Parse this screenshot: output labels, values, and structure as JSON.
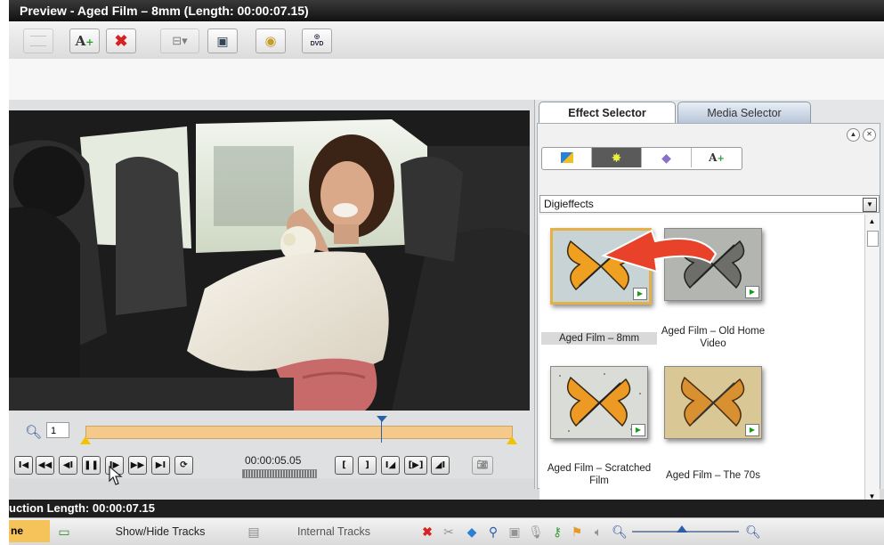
{
  "window": {
    "title": "Preview - Aged Film – 8mm (Length: 00:00:07.15)"
  },
  "toolbar": {
    "buttons": [
      "blank-icon",
      "add-title-icon",
      "delete-icon",
      "align-dropdown-icon",
      "edit-icon",
      "sphere-icon",
      "dvd-icon"
    ],
    "dvd_label": "DVD"
  },
  "preview": {
    "zoom_value": "1",
    "timecode": "00:00:05.05",
    "playhead_fraction": 0.69,
    "progress_fraction": 0.55
  },
  "tabs": {
    "effect_selector": "Effect Selector",
    "media_selector": "Media Selector"
  },
  "effects": {
    "category": "Digieffects",
    "category_tool_text": "A",
    "items": [
      {
        "label": "Aged Film – 8mm",
        "selected": true,
        "style": "color"
      },
      {
        "label": "Aged Film – Old Home Video",
        "selected": false,
        "style": "gray"
      },
      {
        "label": "Aged Film – Scratched Film",
        "selected": false,
        "style": "speckle"
      },
      {
        "label": "Aged Film – The 70s",
        "selected": false,
        "style": "sepia"
      }
    ]
  },
  "bottom": {
    "production_length": "uction Length: 00:00:07.15",
    "tab_partial": "ne",
    "show_hide_tracks": "Show/Hide Tracks",
    "internal_tracks": "Internal Tracks"
  },
  "colors": {
    "timeline_fill": "#f4c98a",
    "marker_yellow": "#f2c300",
    "highlight_selection": "#e3b04a",
    "delete_red": "#d62222"
  }
}
